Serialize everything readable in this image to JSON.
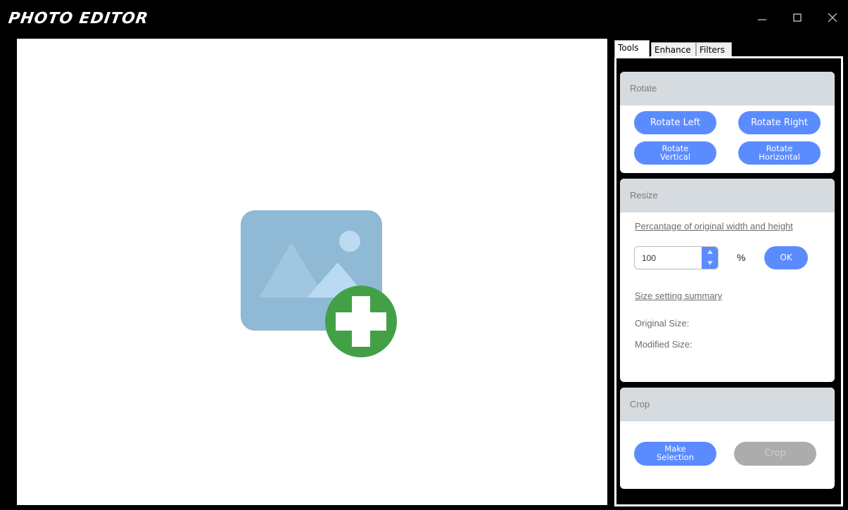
{
  "app": {
    "title": "PHOTO EDITOR",
    "window_controls": [
      "minimize-icon",
      "maximize-icon",
      "close-icon"
    ]
  },
  "canvas": {
    "placeholder_icon": "add-image-icon",
    "colors": {
      "picture": "#8fb9d4",
      "mountain": "#a9cde6",
      "plus_circle": "#43a047"
    }
  },
  "tabs": [
    {
      "label": "Tools",
      "active": true
    },
    {
      "label": "Enhance",
      "active": false
    },
    {
      "label": "Filters",
      "active": false
    }
  ],
  "rotate": {
    "header": "Rotate",
    "buttons": {
      "left": "Rotate Left",
      "right": "Rotate Right",
      "vertical_l1": "Rotate",
      "vertical_l2": "Vertical",
      "horizontal_l1": "Rotate",
      "horizontal_l2": "Horizontal"
    }
  },
  "resize": {
    "header": "Resize",
    "percent_link": "Percantage of original width and height",
    "value": "100",
    "percent_symbol": "%",
    "ok_label": "OK",
    "summary_link": "Size setting summary",
    "original_label": "Original Size:",
    "modified_label": "Modified Size:"
  },
  "crop": {
    "header": "Crop",
    "make_l1": "Make",
    "make_l2": "Selection",
    "crop_label": "Crop"
  },
  "accent_color": "#5b8cff"
}
